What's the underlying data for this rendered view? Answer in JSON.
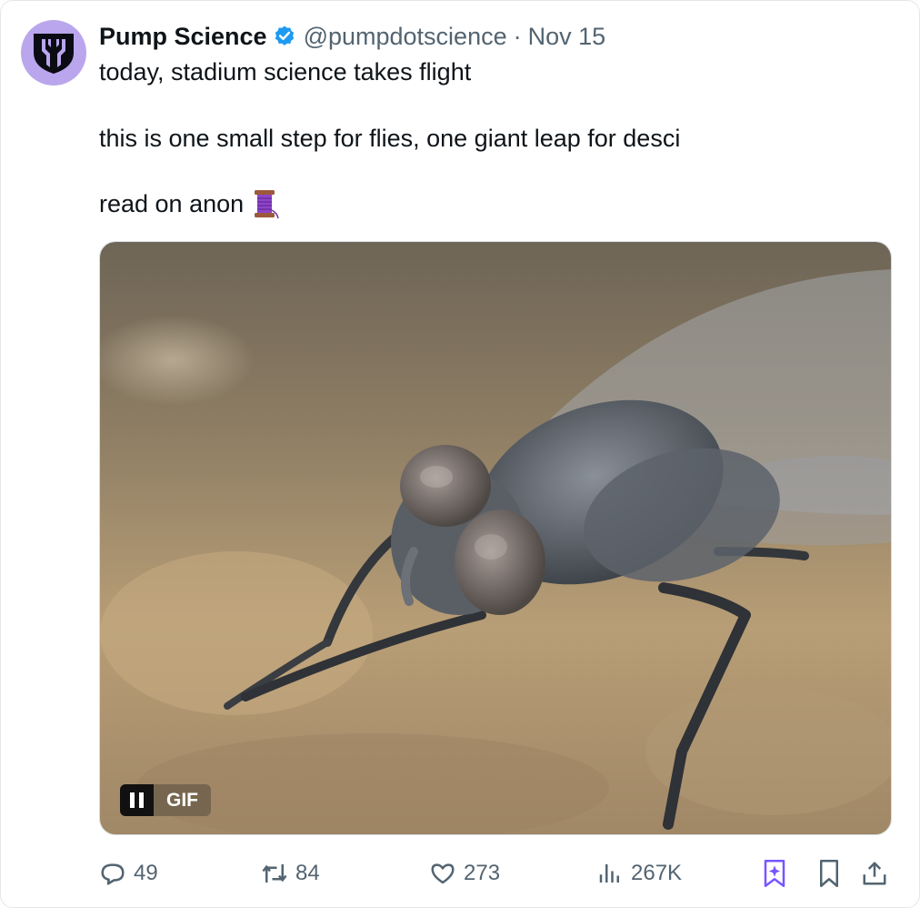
{
  "author": {
    "display_name": "Pump Science",
    "handle": "@pumpdotscience",
    "separator": "·",
    "date": "Nov 15",
    "verified": true,
    "avatar_icon": "pump-science-logo-icon",
    "avatar_color": "#b9a6ec"
  },
  "tweet": {
    "lines": [
      "today, stadium science takes flight",
      "this is one small step for flies, one giant leap for desci",
      "read on anon"
    ],
    "emoji": "thread-spool-emoji"
  },
  "media": {
    "type": "GIF",
    "badge_label": "GIF",
    "pause_icon": "pause-icon",
    "description_icon": "housefly-gif"
  },
  "actions": {
    "replies": "49",
    "reposts": "84",
    "likes": "273",
    "views": "267K"
  },
  "colors": {
    "text_primary": "#0f1419",
    "text_secondary": "#536471",
    "verified_blue": "#1d9bf0",
    "accent_purple": "#7856ff"
  }
}
